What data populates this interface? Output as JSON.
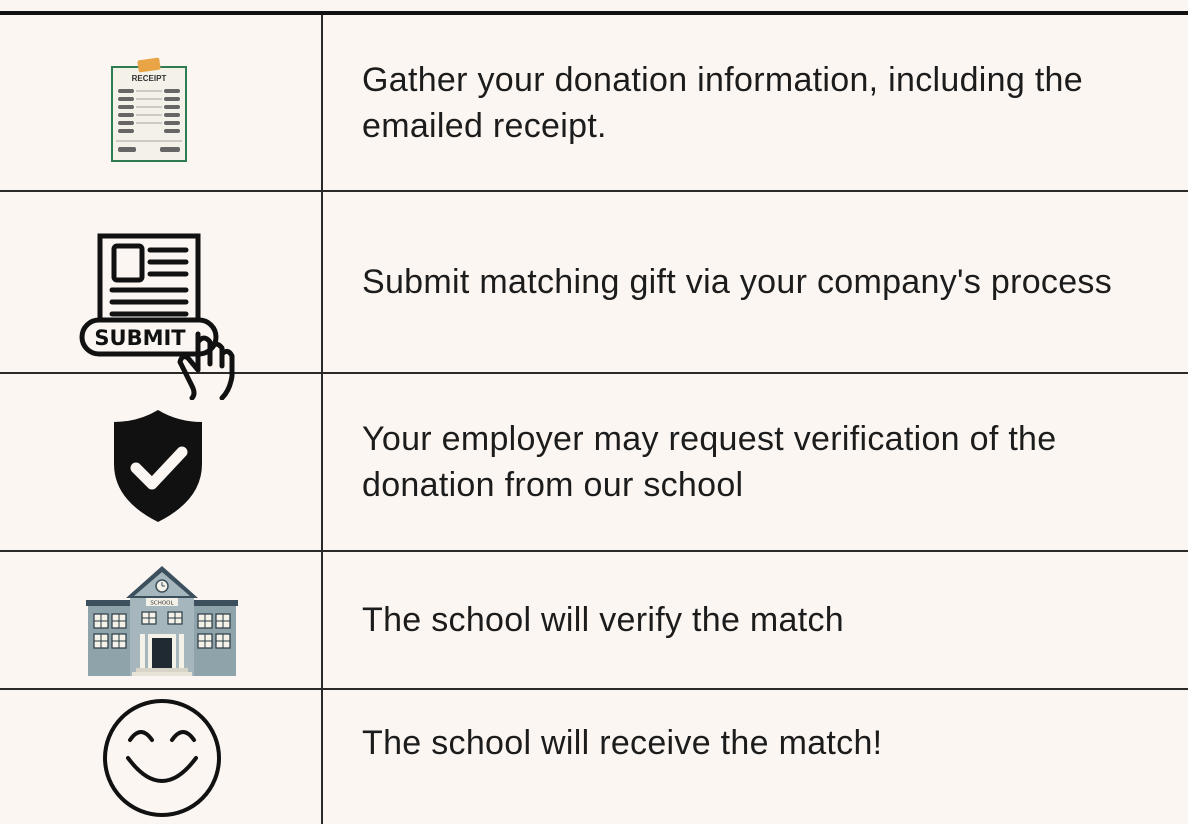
{
  "steps": [
    {
      "icon": "receipt-icon",
      "icon_label": "RECEIPT",
      "text": "Gather your donation information, including the emailed receipt."
    },
    {
      "icon": "submit-form-icon",
      "icon_label": "SUBMIT",
      "text": "Submit matching gift via your company's process"
    },
    {
      "icon": "shield-check-icon",
      "text": "Your employer may request verification of the donation from our school"
    },
    {
      "icon": "school-building-icon",
      "icon_label": "SCHOOL",
      "text": "The school will verify the match"
    },
    {
      "icon": "smiley-face-icon",
      "text": "The school will receive the match!"
    }
  ],
  "colors": {
    "background": "#fbf6f2",
    "line": "#2a2a2a",
    "receipt_green": "#2e7d52",
    "receipt_tab": "#e8a445",
    "school_wall": "#8fa3ab",
    "school_roof": "#3c4f5c"
  }
}
